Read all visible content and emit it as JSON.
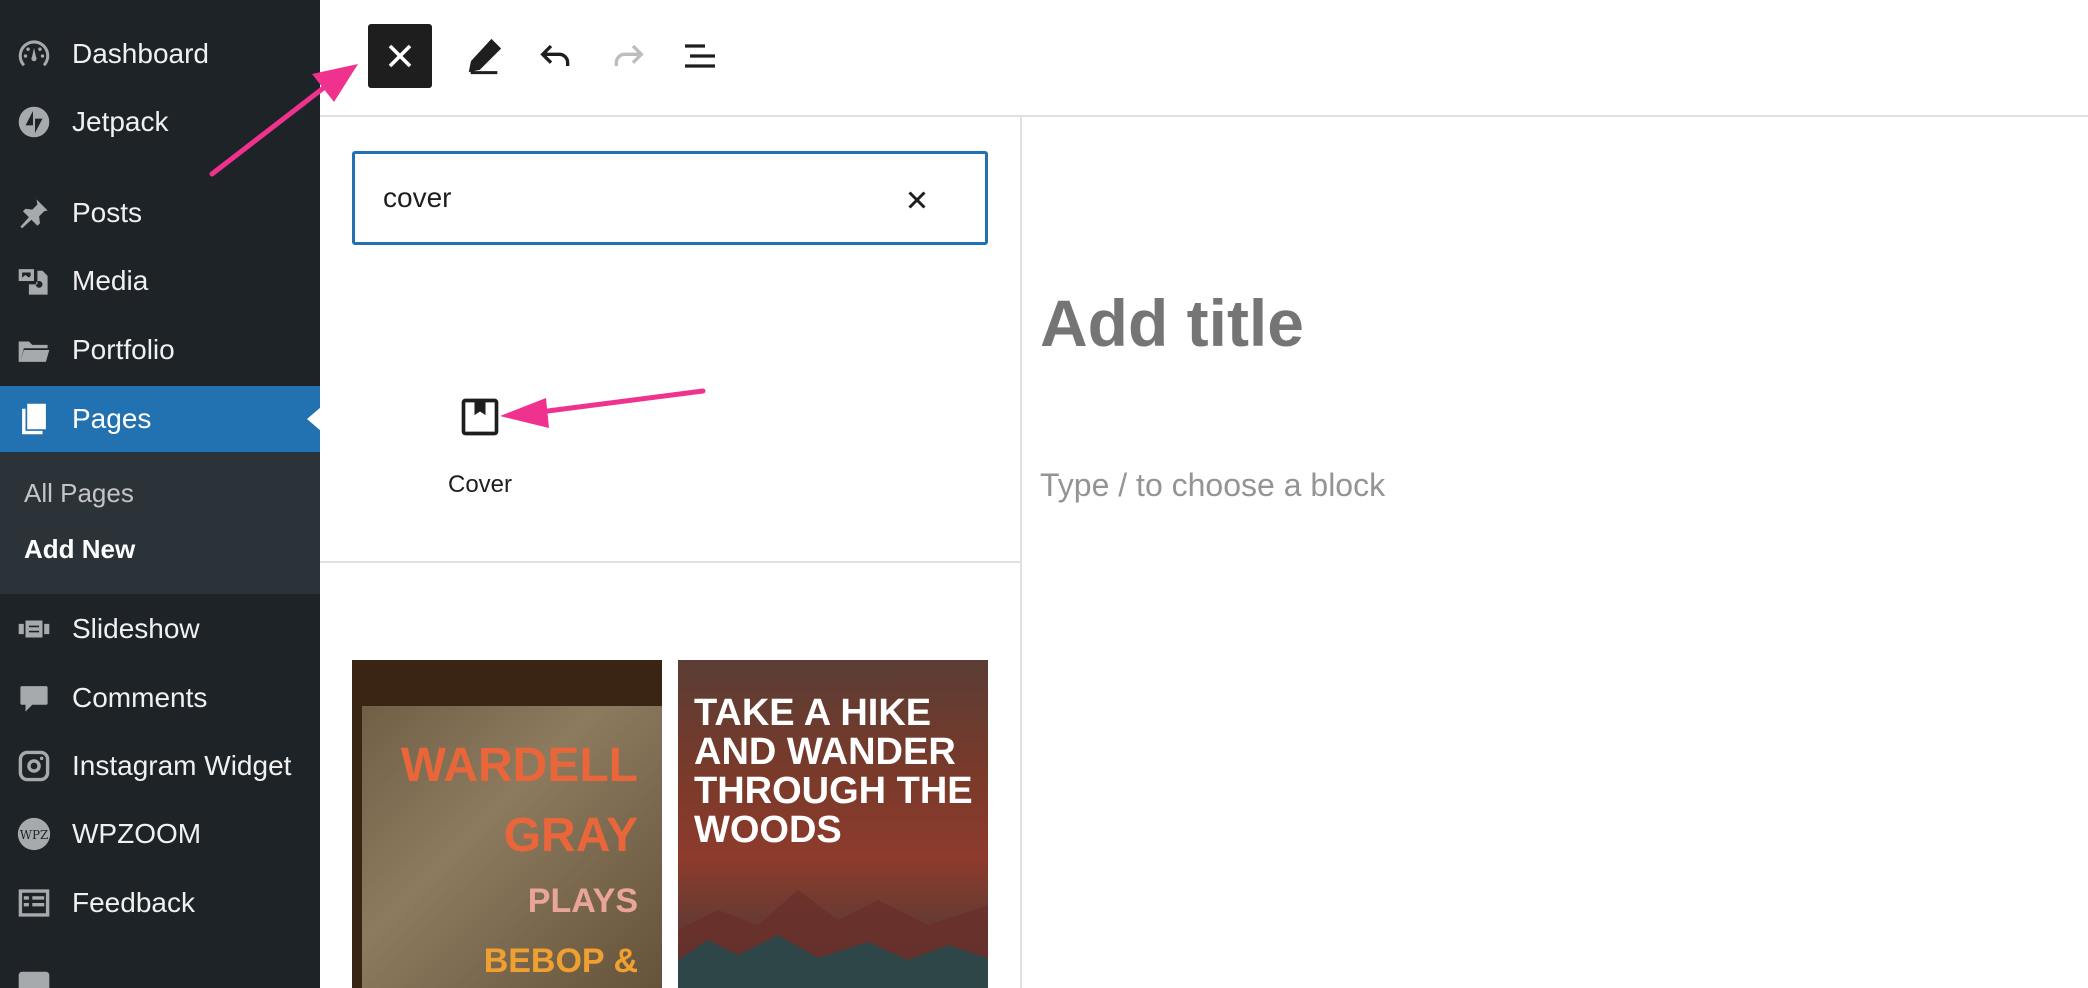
{
  "sidebar": {
    "items": [
      {
        "label": "Dashboard",
        "icon": "dashboard-icon"
      },
      {
        "label": "Jetpack",
        "icon": "jetpack-icon"
      },
      {
        "label": "Posts",
        "icon": "pin-icon"
      },
      {
        "label": "Media",
        "icon": "media-icon"
      },
      {
        "label": "Portfolio",
        "icon": "folder-icon"
      },
      {
        "label": "Pages",
        "icon": "pages-icon",
        "active": true
      },
      {
        "label": "Slideshow",
        "icon": "slideshow-icon"
      },
      {
        "label": "Comments",
        "icon": "comment-icon"
      },
      {
        "label": "Instagram Widget",
        "icon": "instagram-icon"
      },
      {
        "label": "WPZOOM",
        "icon": "wpzoom-icon"
      },
      {
        "label": "Feedback",
        "icon": "feedback-icon"
      }
    ],
    "submenu": [
      {
        "label": "All Pages"
      },
      {
        "label": "Add New",
        "current": true
      }
    ],
    "accent_color": "#2271b1"
  },
  "toolbar": {
    "buttons": [
      "close-inserter",
      "tools-edit",
      "undo",
      "redo",
      "document-overview"
    ]
  },
  "inserter": {
    "search_value": "cover",
    "results": [
      {
        "label": "Cover",
        "icon": "cover-icon"
      }
    ],
    "patterns": [
      {
        "lines": [
          "WARDELL",
          "GRAY",
          "PLAYS",
          "BEBOP &"
        ]
      },
      {
        "text": "TAKE A HIKE AND WANDER THROUGH THE WOODS"
      }
    ]
  },
  "editor": {
    "title_placeholder": "Add title",
    "block_placeholder": "Type / to choose a block"
  },
  "annotation_color": "#f0328f"
}
